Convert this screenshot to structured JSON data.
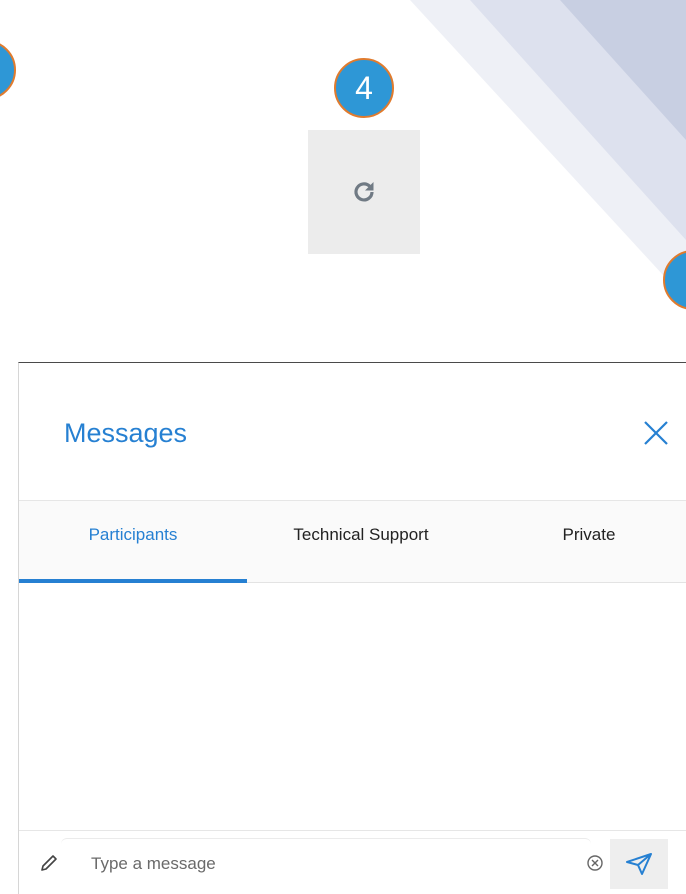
{
  "callouts": {
    "left": "",
    "center": "4",
    "right": ""
  },
  "icons": {
    "refresh": "refresh-icon",
    "close": "close-icon",
    "pencil": "pencil-icon",
    "clear": "clear-circle-x-icon",
    "send": "paper-plane-send-icon"
  },
  "panel": {
    "title": "Messages",
    "tabs": [
      {
        "label": "Participants",
        "active": true
      },
      {
        "label": "Technical Support",
        "active": false
      },
      {
        "label": "Private",
        "active": false
      }
    ],
    "composer": {
      "value": "",
      "placeholder": "Type a message"
    }
  },
  "colors": {
    "accent": "#2680d2",
    "callout_fill": "#2e97d6",
    "callout_border": "#e07b2e"
  }
}
